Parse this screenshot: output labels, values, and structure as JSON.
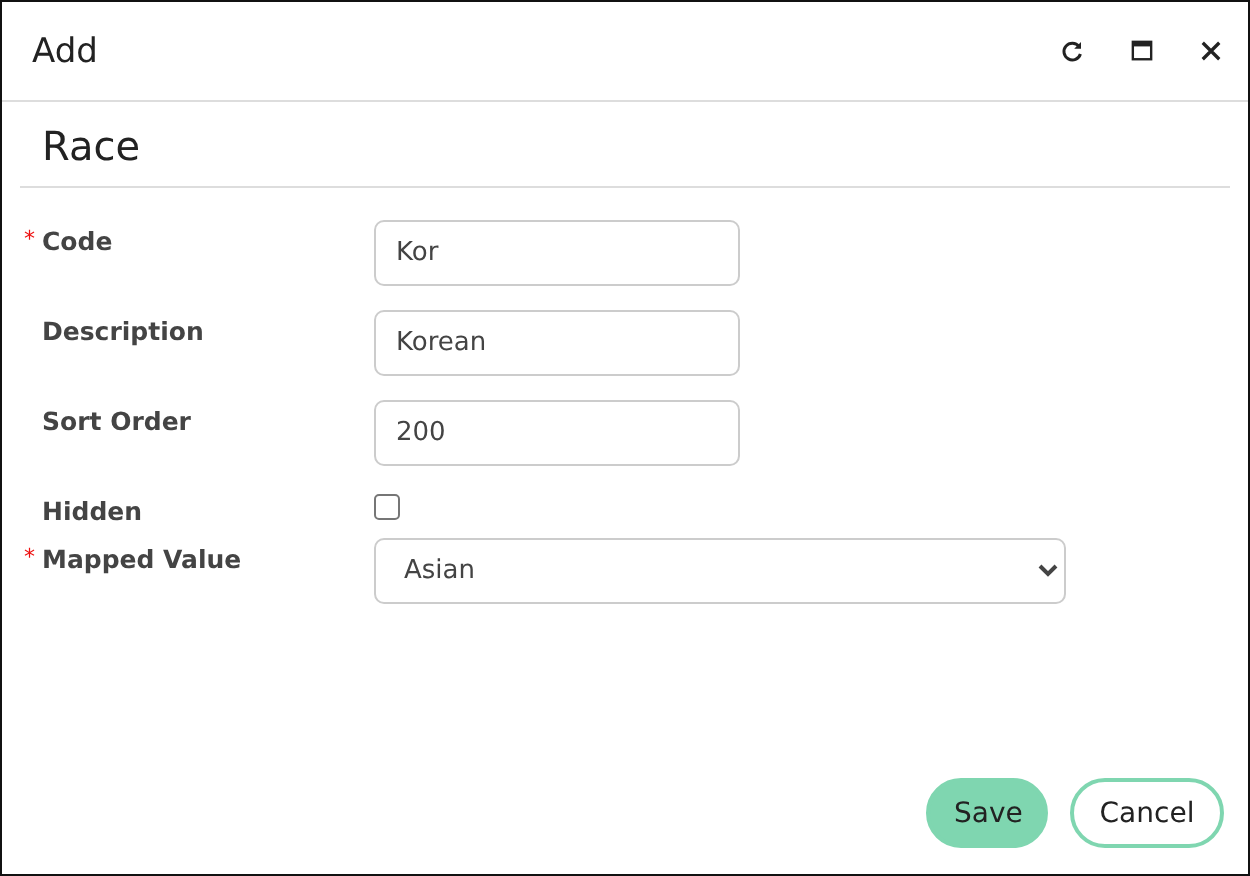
{
  "window": {
    "title": "Add"
  },
  "form": {
    "title": "Race",
    "fields": [
      {
        "kind": "text",
        "label": "Code",
        "required": true,
        "value": "Kor"
      },
      {
        "kind": "text",
        "label": "Description",
        "required": false,
        "value": "Korean"
      },
      {
        "kind": "text",
        "label": "Sort Order",
        "required": false,
        "value": "200"
      },
      {
        "kind": "checkbox",
        "label": "Hidden",
        "required": false,
        "checked": false
      },
      {
        "kind": "select",
        "label": "Mapped Value",
        "required": true,
        "value": "Asian"
      }
    ]
  },
  "required_mark": "*",
  "buttons": [
    {
      "kind": "primary",
      "label": "Save"
    },
    {
      "kind": "secondary",
      "label": "Cancel"
    }
  ]
}
